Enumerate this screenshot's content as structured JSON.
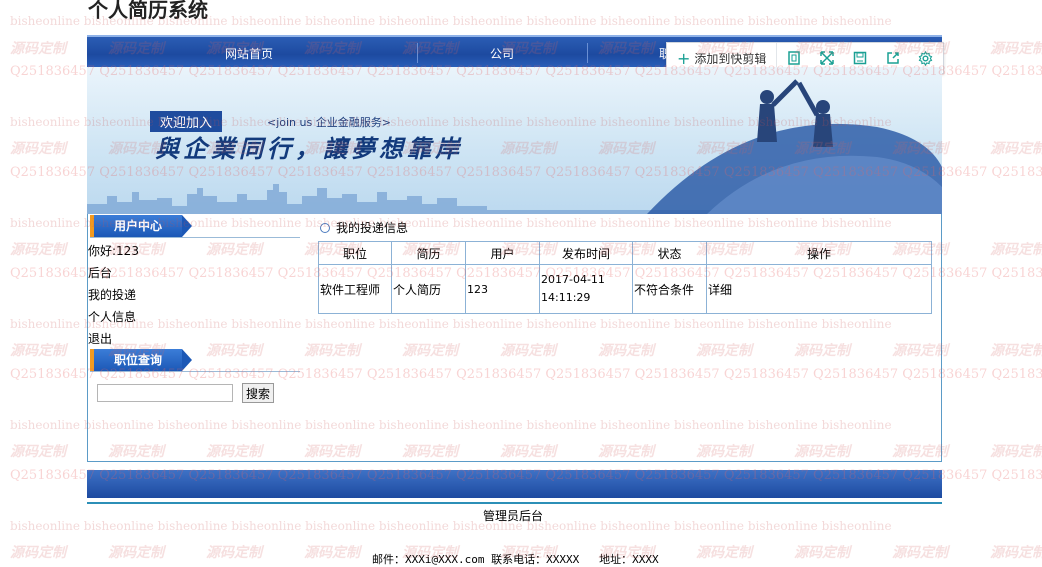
{
  "page_title": "个人简历系统",
  "nav": {
    "items": [
      "网站首页",
      "公司",
      "职"
    ]
  },
  "toolbar": {
    "clip_label": "添加到快剪辑",
    "buttons": [
      "window-icon",
      "expand-icon",
      "save-icon",
      "share-icon",
      "settings-icon"
    ],
    "accent": "#1aa094"
  },
  "banner": {
    "join_label": "欢迎加入",
    "join_sub": "<join us  企业金融服务>",
    "slogan": "與企業同行，讓夢想靠岸"
  },
  "sidebar": {
    "user_center_title": "用户中心",
    "greeting": "你好:123",
    "links": [
      "后台",
      "我的投递",
      "个人信息",
      "退出"
    ],
    "job_search_title": "职位查询",
    "search_placeholder": "",
    "search_button": "搜索"
  },
  "main": {
    "section_title": "我的投递信息",
    "columns": [
      "职位",
      "简历",
      "用户",
      "发布时间",
      "状态",
      "操作"
    ],
    "rows": [
      {
        "position": "软件工程师",
        "resume": "个人简历",
        "user": "123",
        "date": "2017-04-11",
        "time": "14:11:29",
        "status": "不符合条件",
        "action": "详细"
      }
    ]
  },
  "footer": {
    "admin_link": "管理员后台",
    "contact": "邮件：XXXi@XXX.com 联系电话：XXXXX   地址：XXXX"
  },
  "watermark": {
    "line_a": "bisheonline",
    "line_b": "源码定制",
    "line_c": "Q2518364 57"
  }
}
